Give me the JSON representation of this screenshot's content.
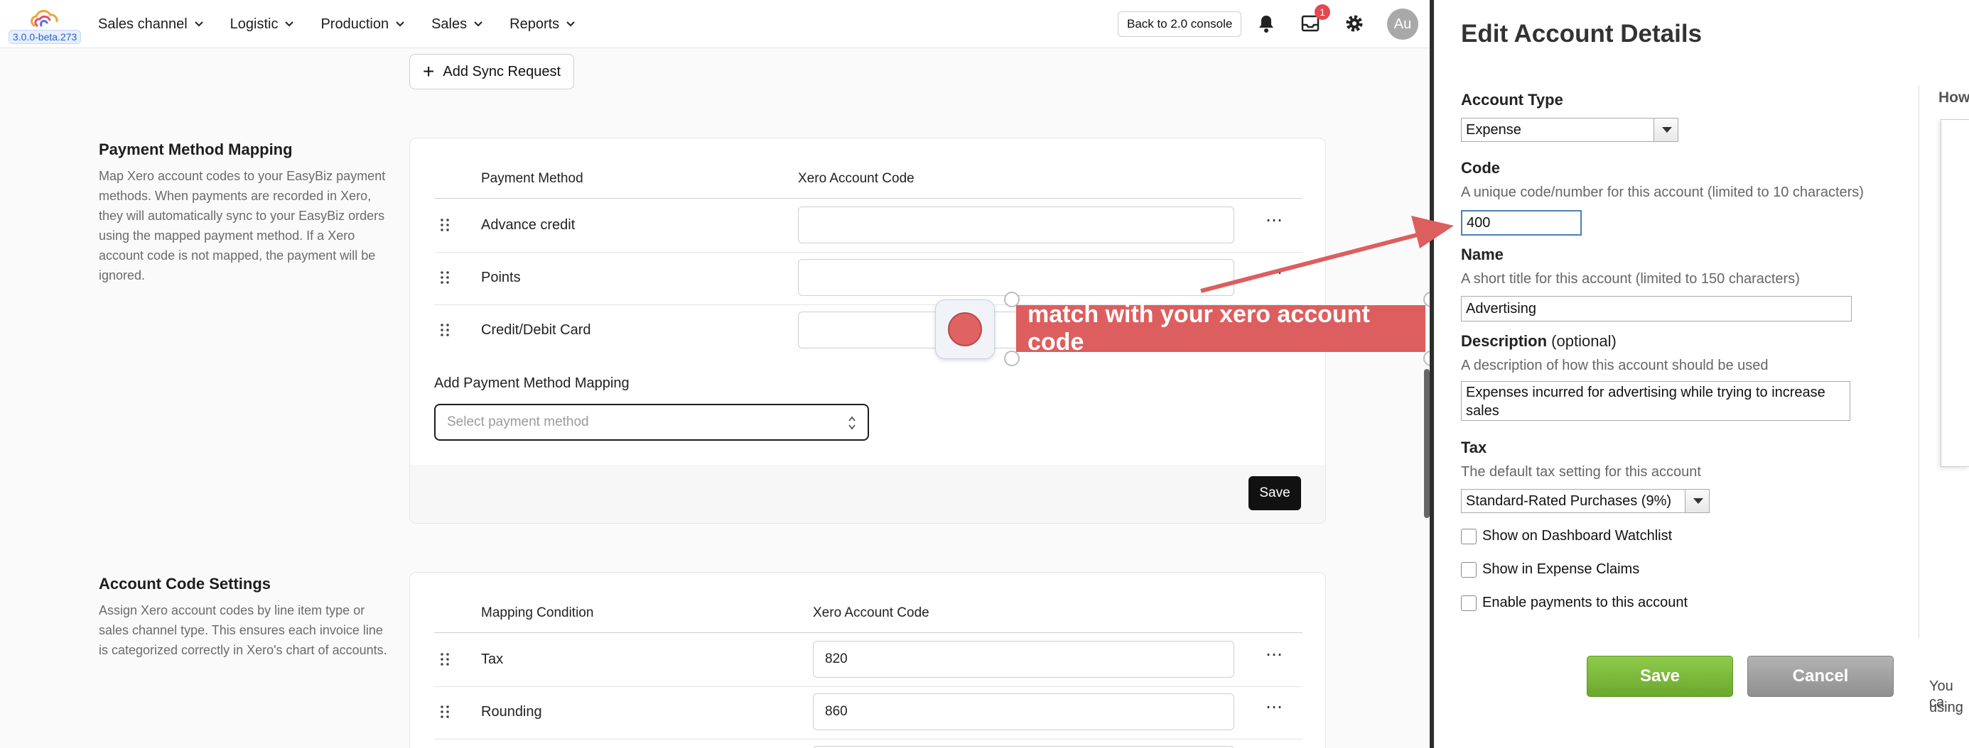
{
  "app": {
    "version": "3.0.0-beta.273",
    "nav": [
      "Sales channel",
      "Logistic",
      "Production",
      "Sales",
      "Reports"
    ],
    "console_button": "Back to 2.0 console",
    "inbox_badge": "1",
    "avatar": "Au",
    "add_sync": "Add Sync Request"
  },
  "payment_mapping": {
    "title": "Payment Method Mapping",
    "description": "Map Xero account codes to your EasyBiz payment methods. When payments are recorded in Xero, they will automatically sync to your EasyBiz orders using the mapped payment method. If a Xero account code is not mapped, the payment will be ignored.",
    "col_method": "Payment Method",
    "col_code": "Xero Account Code",
    "rows": [
      {
        "label": "Advance credit",
        "code": ""
      },
      {
        "label": "Points",
        "code": ""
      },
      {
        "label": "Credit/Debit Card",
        "code": ""
      }
    ],
    "add_label": "Add Payment Method Mapping",
    "select_placeholder": "Select payment method",
    "save": "Save"
  },
  "account_code": {
    "title": "Account Code Settings",
    "description": "Assign Xero account codes by line item type or sales channel type. This ensures each invoice line is categorized correctly in Xero's chart of accounts.",
    "col_condition": "Mapping Condition",
    "col_code": "Xero Account Code",
    "rows": [
      {
        "label": "Tax",
        "code": "820"
      },
      {
        "label": "Rounding",
        "code": "860"
      }
    ]
  },
  "annotation": {
    "text": "match with your xero account code",
    "color": "#dd5e5e"
  },
  "panel": {
    "title": "Edit Account Details",
    "account_type_label": "Account Type",
    "account_type_value": "Expense",
    "code_label": "Code",
    "code_hint": "A unique code/number for this account (limited to 10 characters)",
    "code_value": "400",
    "name_label": "Name",
    "name_hint": "A short title for this account (limited to 150 characters)",
    "name_value": "Advertising",
    "desc_label": "Description",
    "desc_optional": "(optional)",
    "desc_hint": "A description of how this account should be used",
    "desc_value": "Expenses incurred for advertising while trying to increase sales",
    "tax_label": "Tax",
    "tax_hint": "The default tax setting for this account",
    "tax_value": "Standard-Rated Purchases (9%)",
    "checks": [
      "Show on Dashboard Watchlist",
      "Show in Expense Claims",
      "Enable payments to this account"
    ],
    "save": "Save",
    "cancel": "Cancel",
    "side_heading": "How",
    "side_note_1": "You ca",
    "side_note_2": "using"
  },
  "colors": {
    "accent_green": "#6aa82e",
    "badge_red": "#e5484d",
    "focus_blue": "#4a7ebb"
  }
}
